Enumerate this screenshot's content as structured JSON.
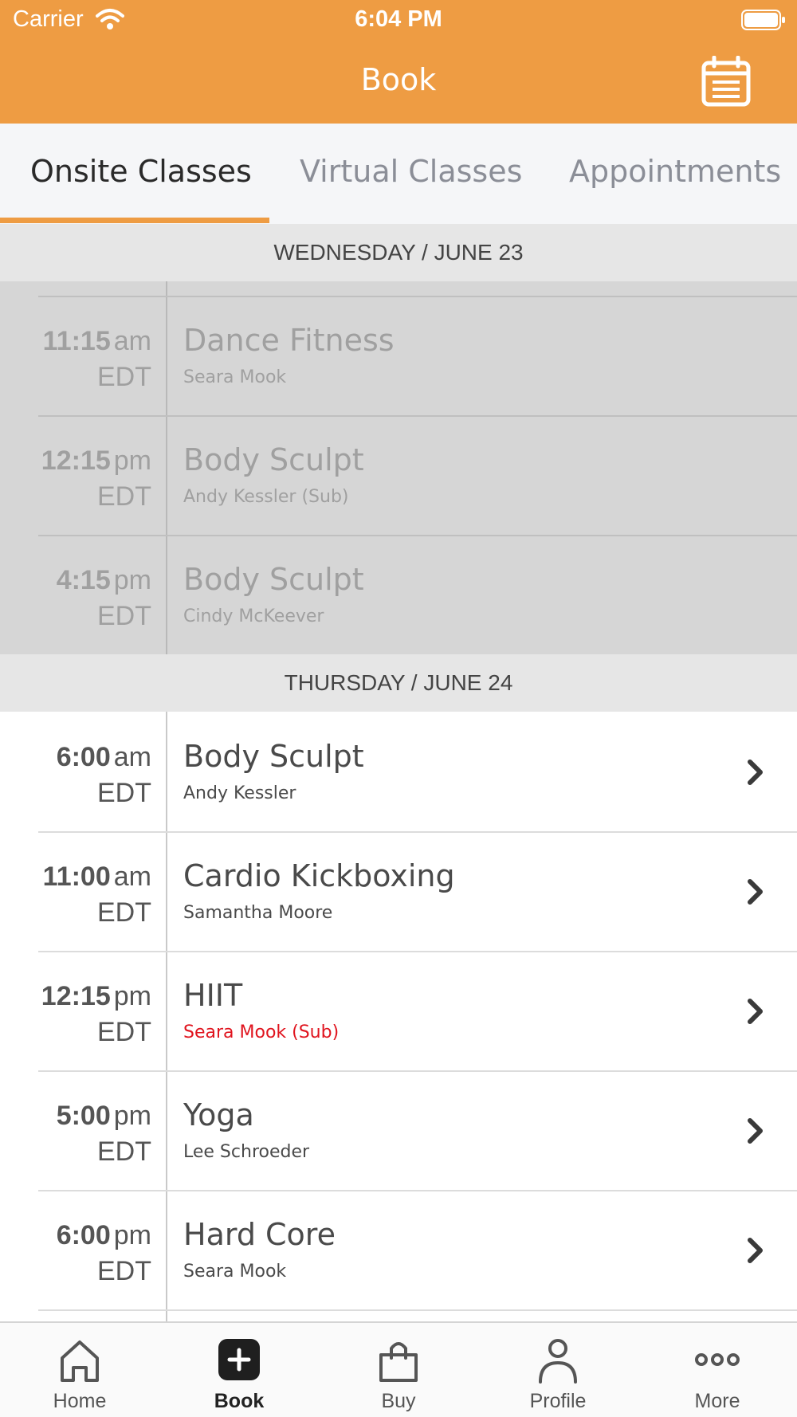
{
  "status_bar": {
    "carrier": "Carrier",
    "time": "6:04 PM"
  },
  "nav": {
    "title": "Book"
  },
  "tabs": [
    {
      "label": "Onsite Classes",
      "active": true
    },
    {
      "label": "Virtual Classes",
      "active": false
    },
    {
      "label": "Appointments",
      "active": false
    }
  ],
  "days": [
    {
      "header": "WEDNESDAY / JUNE 23",
      "past": true,
      "classes": [
        {
          "time": "11:15",
          "ampm": "am",
          "tz": "EDT",
          "name": "Dance Fitness",
          "instructor": "Seara Mook"
        },
        {
          "time": "12:15",
          "ampm": "pm",
          "tz": "EDT",
          "name": "Body Sculpt",
          "instructor": "Andy Kessler (Sub)"
        },
        {
          "time": "4:15",
          "ampm": "pm",
          "tz": "EDT",
          "name": "Body Sculpt",
          "instructor": "Cindy McKeever"
        }
      ]
    },
    {
      "header": "THURSDAY / JUNE 24",
      "past": false,
      "classes": [
        {
          "time": "6:00",
          "ampm": "am",
          "tz": "EDT",
          "name": "Body Sculpt",
          "instructor": "Andy Kessler",
          "sub": false
        },
        {
          "time": "11:00",
          "ampm": "am",
          "tz": "EDT",
          "name": "Cardio Kickboxing",
          "instructor": "Samantha Moore",
          "sub": false
        },
        {
          "time": "12:15",
          "ampm": "pm",
          "tz": "EDT",
          "name": "HIIT",
          "instructor": "Seara Mook (Sub)",
          "sub": true
        },
        {
          "time": "5:00",
          "ampm": "pm",
          "tz": "EDT",
          "name": "Yoga",
          "instructor": "Lee Schroeder",
          "sub": false
        },
        {
          "time": "6:00",
          "ampm": "pm",
          "tz": "EDT",
          "name": "Hard Core",
          "instructor": "Seara Mook",
          "sub": false
        }
      ]
    }
  ],
  "tabbar": [
    {
      "label": "Home",
      "icon": "home-icon",
      "active": false
    },
    {
      "label": "Book",
      "icon": "plus-icon",
      "active": true
    },
    {
      "label": "Buy",
      "icon": "shopping-bag-icon",
      "active": false
    },
    {
      "label": "Profile",
      "icon": "person-icon",
      "active": false
    },
    {
      "label": "More",
      "icon": "more-icon",
      "active": false
    }
  ],
  "colors": {
    "accent": "#ee9c43",
    "sub_alert": "#e0141e",
    "past_bg": "#d6d6d6",
    "day_header_bg": "#e6e6e6"
  }
}
